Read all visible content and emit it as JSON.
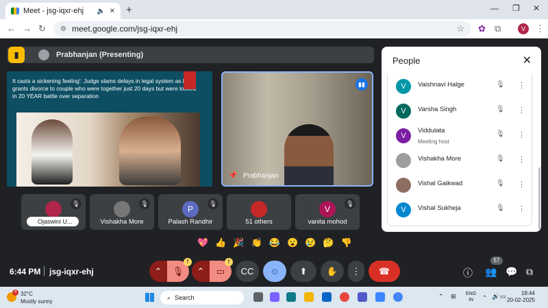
{
  "browser": {
    "tab_title": "Meet - jsg-iqxr-ehj",
    "url": "meet.google.com/jsg-iqxr-ehj",
    "profile_initial": "V"
  },
  "meet": {
    "presenting_label": "Prabhanjan (Presenting)",
    "slide_text": "It casts a sickening feeling': Judge slams delays in legal system as he grants divorce to couple who were together just 20 days but were locked in 20 YEAR battle over separation",
    "camera_name": "Prabhanjan",
    "tiles": [
      {
        "name": "Ojaswini U...",
        "avatar": "",
        "color": "#b1254a"
      },
      {
        "name": "Vishakha More",
        "avatar": "",
        "color": "#777777"
      },
      {
        "name": "Palash Randhir",
        "avatar": "P",
        "color": "#5c6bc0"
      },
      {
        "name": "51 others",
        "avatar": "",
        "color": "#c62828"
      },
      {
        "name": "vanita mohod",
        "avatar": "V",
        "color": "#ad1457"
      }
    ],
    "reactions": [
      "💖",
      "👍",
      "🎉",
      "👏",
      "😂",
      "😮",
      "😢",
      "🤔",
      "👎"
    ],
    "time": "6:44 PM",
    "meeting_code": "jsg-iqxr-ehj",
    "participant_count": "57"
  },
  "people_panel": {
    "title": "People",
    "participants": [
      {
        "name": "Vaishnavi Halge",
        "initial": "V",
        "color": "#0097a7",
        "role": ""
      },
      {
        "name": "Varsha Singh",
        "initial": "V",
        "color": "#00695c",
        "role": ""
      },
      {
        "name": "Viddulata",
        "initial": "V",
        "color": "#7b1fa2",
        "role": "Meeting host"
      },
      {
        "name": "Vishakha More",
        "initial": "",
        "color": "#9e9e9e",
        "role": ""
      },
      {
        "name": "Vishal Gaikwad",
        "initial": "",
        "color": "#8d6e63",
        "role": ""
      },
      {
        "name": "Vishal Sukheja",
        "initial": "V",
        "color": "#0288d1",
        "role": ""
      }
    ]
  },
  "taskbar": {
    "weather_badge": "4",
    "temperature": "32°C",
    "condition": "Mostly sunny",
    "search_label": "Search",
    "lang_line1": "ENG",
    "lang_line2": "IN",
    "clock_time": "18:44",
    "clock_date": "20-02-2025"
  }
}
